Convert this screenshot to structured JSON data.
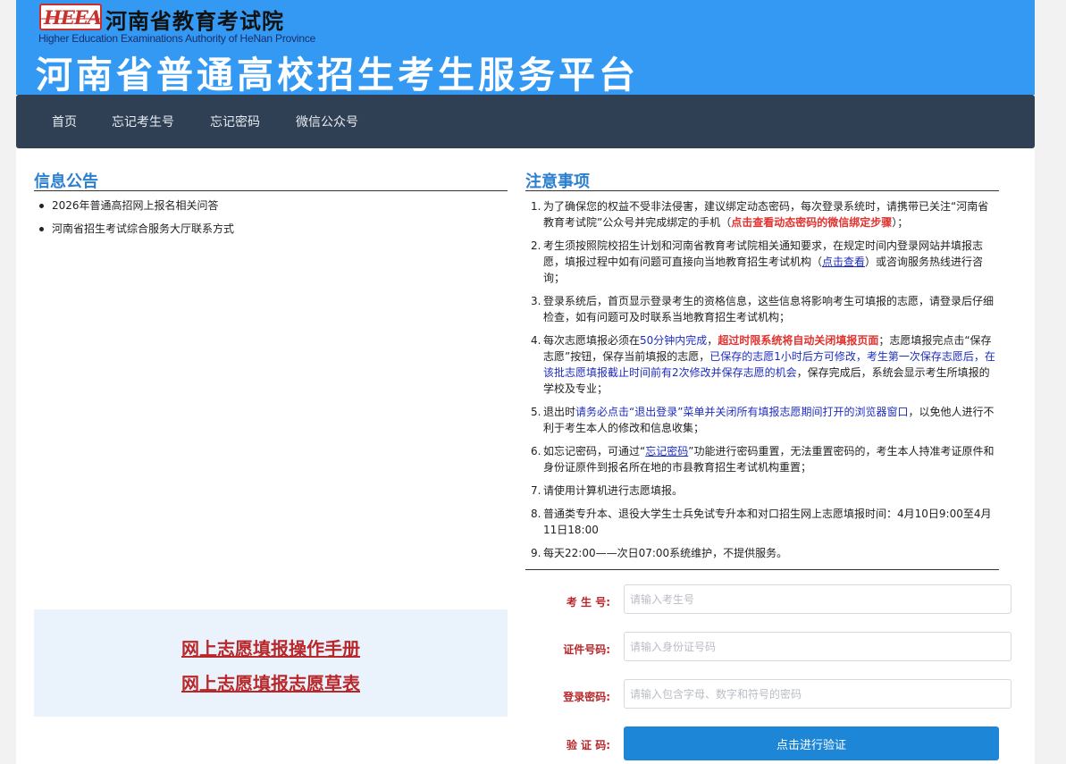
{
  "header": {
    "logo_text": "HEEA",
    "authority_cn": "河南省教育考试院",
    "authority_en": "Higher Education Examinations Authority of HeNan Province",
    "platform_title": "河南省普通高校招生考生服务平台"
  },
  "nav": {
    "items": [
      {
        "label": "首页"
      },
      {
        "label": "忘记考生号"
      },
      {
        "label": "忘记密码"
      },
      {
        "label": "微信公众号"
      }
    ]
  },
  "announcements": {
    "title": "信息公告",
    "items": [
      {
        "label": "2026年普通高招网上报名相关问答"
      },
      {
        "label": "河南省招生考试综合服务大厅联系方式"
      }
    ]
  },
  "downloads": {
    "links": [
      {
        "label": "网上志愿填报操作手册"
      },
      {
        "label": "网上志愿填报志愿草表"
      }
    ]
  },
  "notes": {
    "title": "注意事项",
    "items": [
      {
        "num": "1.",
        "a": "为了确保您的权益不受非法侵害，建议绑定动态密码，每次登录系统时，请携带已关注“河南省教育考试院”公众号并完成绑定的手机（",
        "b": "点击查看动态密码的微信绑定步骤",
        "c": "）；"
      },
      {
        "num": "2.",
        "a": "考生须按照院校招生计划和河南省教育考试院相关通知要求，在规定时间内登录网站并填报志愿，填报过程中如有问题可直接向当地教育招生考试机构（",
        "link": "点击查看",
        "c": "）或咨询服务热线进行咨询；"
      },
      {
        "num": "3.",
        "a": "登录系统后，首页显示登录考生的资格信息，这些信息将影响考生可填报的志愿，请登录后仔细检查，如有问题可及时联系当地教育招生考试机构；"
      },
      {
        "num": "4.",
        "a": "每次志愿填报必须在",
        "b": "50分钟内完成",
        "c": "，",
        "d": "超过时限系统将自动关闭填报页面",
        "e": "；志愿填报完点击“保存志愿”按钮，保存当前填报的志愿，",
        "f": "已保存的志愿1小时后方可修改，考生第一次保存志愿后，在该批志愿填报截止时间前有2次修改并保存志愿的机会",
        "g": "，保存完成后，系统会显示考生所填报的学校及专业；"
      },
      {
        "num": "5.",
        "a": "退出时",
        "b": "请务必点击“退出登录”菜单并关闭所有填报志愿期间打开的浏览器窗口",
        "c": "，以免他人进行不利于考生本人的修改和信息收集；"
      },
      {
        "num": "6.",
        "a": "如忘记密码，可通过“",
        "link": "忘记密码",
        "c": "”功能进行密码重置，无法重置密码的，考生本人持准考证原件和身份证原件到报名所在地的市县教育招生考试机构重置；"
      },
      {
        "num": "7.",
        "a": "请使用计算机进行志愿填报。"
      },
      {
        "num": "8.",
        "a": "普通类专升本、退役大学生士兵免试专升本和对口招生网上志愿填报时间：4月10日9:00至4月11日18:00"
      },
      {
        "num": "9.",
        "a": "每天22:00——次日07:00系统维护，不提供服务。"
      }
    ]
  },
  "login": {
    "candidate_label": "考 生 号:",
    "candidate_placeholder": "请输入考生号",
    "id_label": "证件号码:",
    "id_placeholder": "请输入身份证号码",
    "password_label": "登录密码:",
    "password_placeholder": "请输入包含字母、数字和符号的密码",
    "captcha_label": "验 证 码:",
    "verify_button": "点击进行验证"
  },
  "colors": {
    "header_bg": "#3399f3",
    "nav_bg": "#2f3f54",
    "accent_blue": "#2b7fd0",
    "link_red": "#b8282b",
    "warning_red": "#e0322f",
    "button_blue": "#1e86d6"
  }
}
